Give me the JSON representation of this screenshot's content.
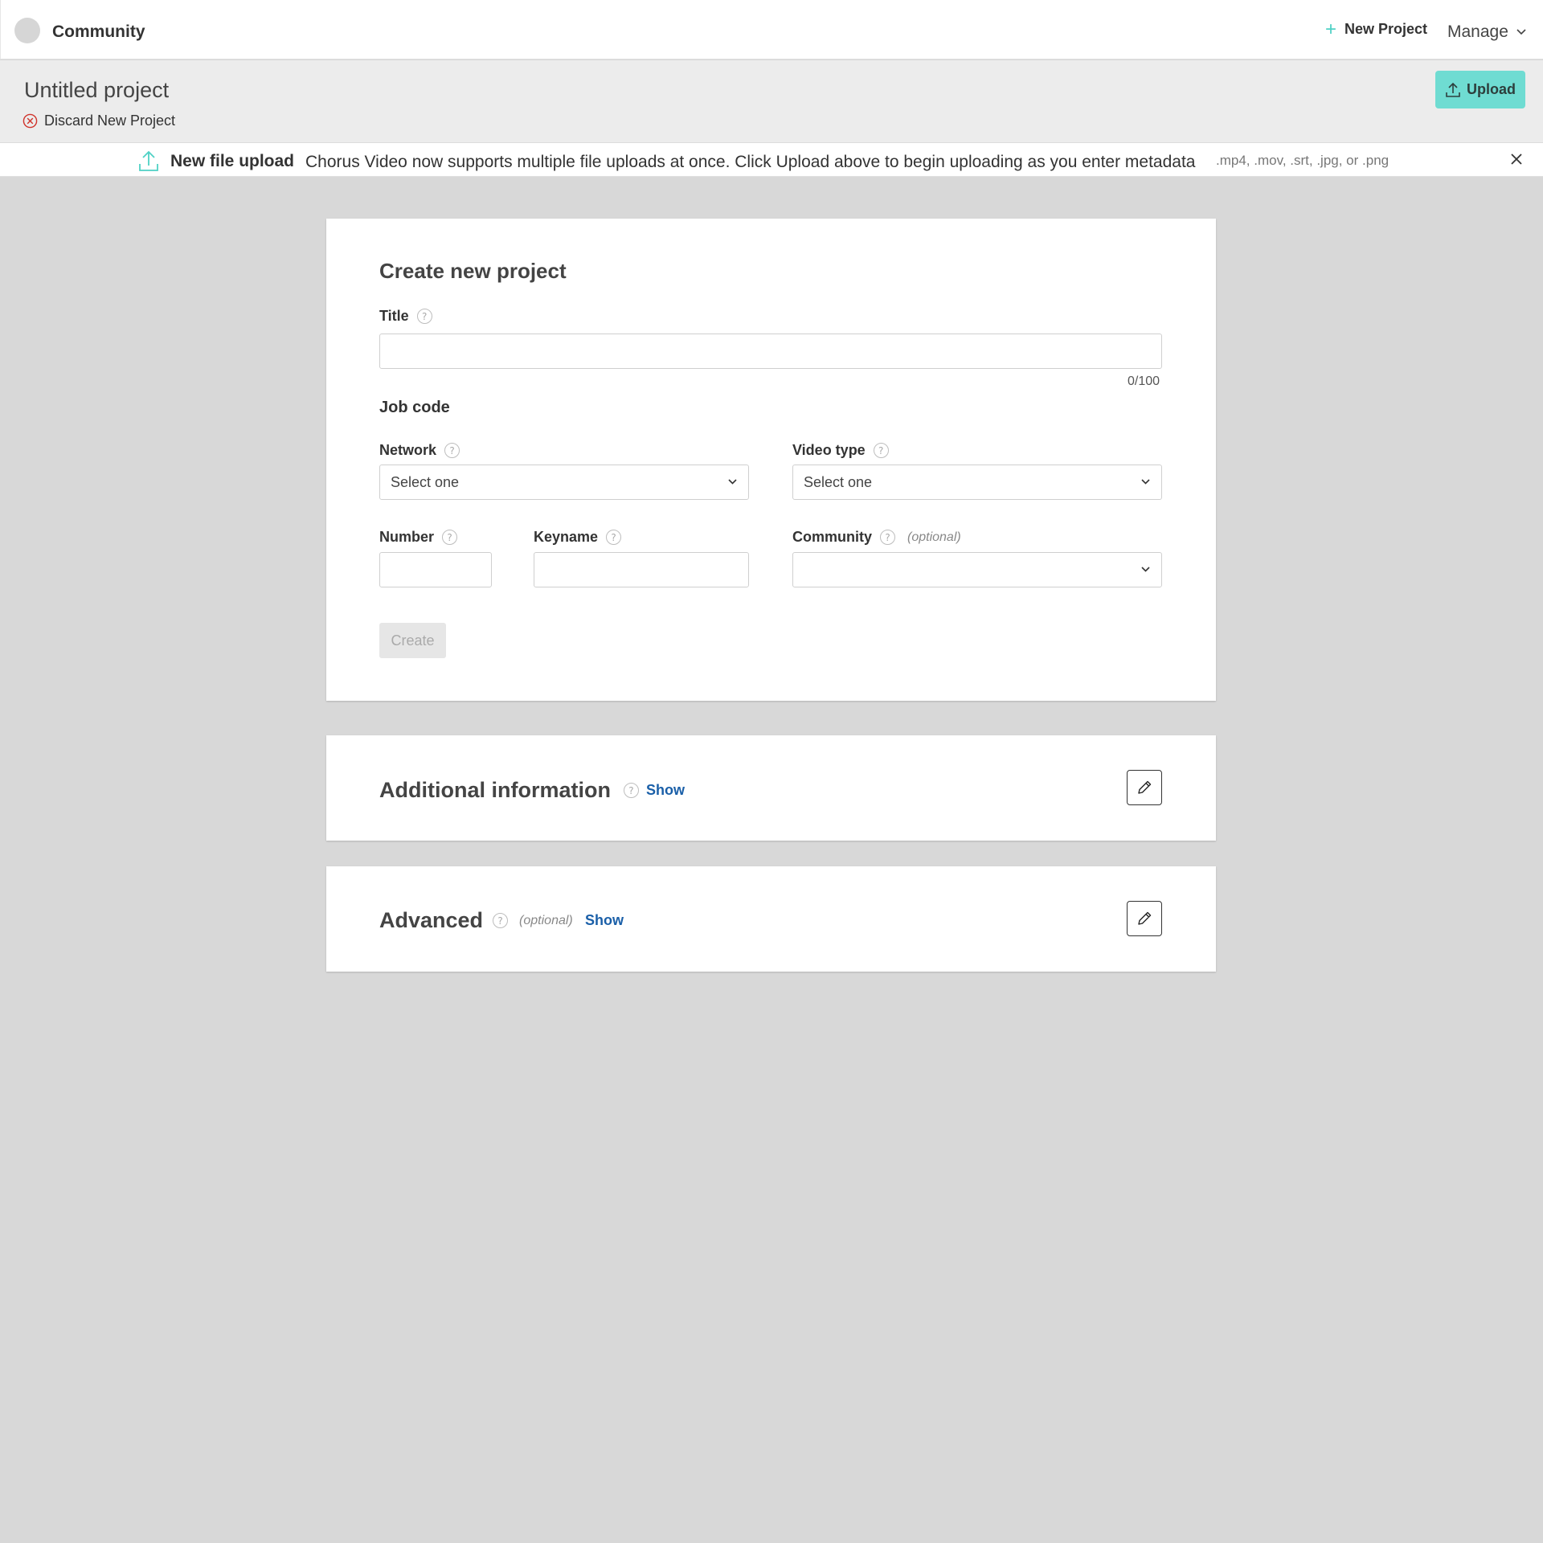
{
  "topnav": {
    "brand": "Community",
    "new_project": "New Project",
    "manage": "Manage"
  },
  "project": {
    "title": "Untitled project",
    "discard": "Discard New Project",
    "upload": "Upload"
  },
  "notice": {
    "title": "New file upload",
    "message": "Chorus Video now supports multiple file uploads at once. Click Upload above to begin uploading as you enter metadata",
    "formats": ".mp4, .mov, .srt, .jpg, or .png"
  },
  "form": {
    "heading": "Create new project",
    "title_label": "Title",
    "title_value": "",
    "title_counter": "0/100",
    "job_code": "Job code",
    "network_label": "Network",
    "network_value": "Select one",
    "video_type_label": "Video type",
    "video_type_value": "Select one",
    "number_label": "Number",
    "number_value": "",
    "keyname_label": "Keyname",
    "keyname_value": "",
    "community_label": "Community",
    "community_optional": "(optional)",
    "community_value": "",
    "create": "Create"
  },
  "additional": {
    "title": "Additional information",
    "show": "Show"
  },
  "advanced": {
    "title": "Advanced",
    "optional": "(optional)",
    "show": "Show"
  },
  "colors": {
    "accent": "#6fdcd2",
    "link": "#1a5fa8",
    "discard_icon": "#d0342c",
    "background": "#d8d8d8"
  },
  "icons": {
    "plus": "plus-icon",
    "chevron": "chevron-down-icon",
    "discard": "close-circle-icon",
    "upload": "upload-icon",
    "close": "close-icon",
    "help": "help-icon",
    "edit": "pencil-icon"
  }
}
